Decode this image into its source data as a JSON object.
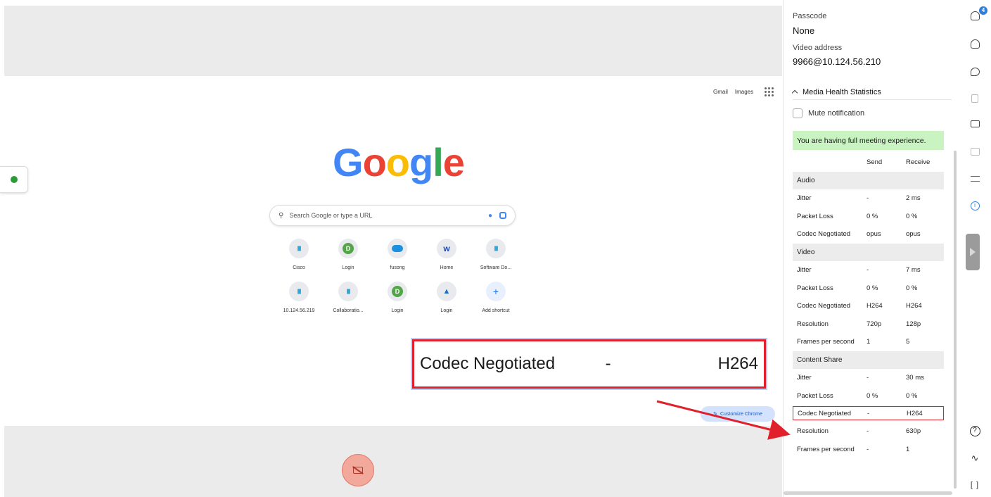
{
  "browser": {
    "top_links": [
      "Gmail",
      "Images"
    ],
    "logo_letters": [
      {
        "ch": "G",
        "color": "#4285F4"
      },
      {
        "ch": "o",
        "color": "#EA4335"
      },
      {
        "ch": "o",
        "color": "#FBBC05"
      },
      {
        "ch": "g",
        "color": "#4285F4"
      },
      {
        "ch": "l",
        "color": "#34A853"
      },
      {
        "ch": "e",
        "color": "#EA4335"
      }
    ],
    "search_placeholder": "Search Google or type a URL",
    "shortcuts": [
      {
        "label": "Cisco",
        "icon": "cisco-icon"
      },
      {
        "label": "Login",
        "icon": "login-icon"
      },
      {
        "label": "fusong",
        "icon": "cloud-icon"
      },
      {
        "label": "Home",
        "icon": "workday-icon"
      },
      {
        "label": "Software Do...",
        "icon": "cisco-icon"
      },
      {
        "label": "10.124.56.219",
        "icon": "cisco-icon"
      },
      {
        "label": "Collaboratio...",
        "icon": "cisco-icon"
      },
      {
        "label": "Login",
        "icon": "login-icon"
      },
      {
        "label": "Login",
        "icon": "upload-icon"
      },
      {
        "label": "Add shortcut",
        "icon": "plus-icon"
      }
    ],
    "customize_label": "Customize Chrome"
  },
  "callout": {
    "label": "Codec Negotiated",
    "send": "-",
    "receive": "H264"
  },
  "panel": {
    "passcode_label": "Passcode",
    "passcode_value": "None",
    "video_address_label": "Video address",
    "video_address_value": "9966@10.124.56.210",
    "section_title": "Media Health Statistics",
    "mute_label": "Mute notification",
    "banner": "You are having full meeting experience.",
    "col_send": "Send",
    "col_receive": "Receive",
    "audio": {
      "title": "Audio",
      "rows": [
        {
          "k": "Jitter",
          "s": "-",
          "r": "2 ms"
        },
        {
          "k": "Packet Loss",
          "s": "0 %",
          "r": "0 %"
        },
        {
          "k": "Codec Negotiated",
          "s": "opus",
          "r": "opus"
        }
      ]
    },
    "video": {
      "title": "Video",
      "rows": [
        {
          "k": "Jitter",
          "s": "-",
          "r": "7 ms"
        },
        {
          "k": "Packet Loss",
          "s": "0 %",
          "r": "0 %"
        },
        {
          "k": "Codec Negotiated",
          "s": "H264",
          "r": "H264"
        },
        {
          "k": "Resolution",
          "s": "720p",
          "r": "128p"
        },
        {
          "k": "Frames per second",
          "s": "1",
          "r": "5"
        }
      ]
    },
    "content": {
      "title": "Content Share",
      "rows": [
        {
          "k": "Jitter",
          "s": "-",
          "r": "30 ms"
        },
        {
          "k": "Packet Loss",
          "s": "0 %",
          "r": "0 %"
        },
        {
          "k": "Codec Negotiated",
          "s": "-",
          "r": "H264"
        },
        {
          "k": "Resolution",
          "s": "-",
          "r": "630p"
        },
        {
          "k": "Frames per second",
          "s": "-",
          "r": "1"
        }
      ]
    }
  },
  "rail": {
    "participants_badge": "4",
    "icons": [
      "participants-icon",
      "contact-icon",
      "chat-icon",
      "notes-icon",
      "caption-icon",
      "whiteboard-icon",
      "settings-icon",
      "info-icon",
      "help-icon",
      "health-icon",
      "fullscreen-icon"
    ]
  },
  "colors": {
    "highlight": "#e0202a",
    "banner": "#c9f3c1",
    "accent": "#2f7fd8"
  }
}
